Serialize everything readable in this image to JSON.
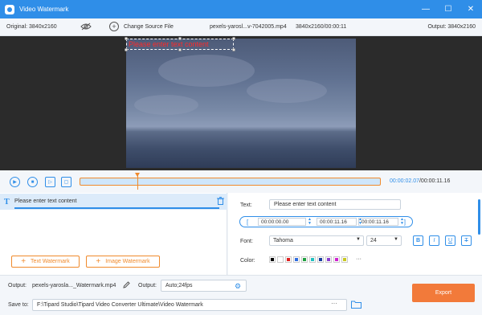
{
  "titlebar": {
    "title": "Video Watermark",
    "minimize": "—",
    "restore": "☐",
    "close": "✕"
  },
  "info": {
    "original": "Original: 3840x2160",
    "change_source": "Change Source File",
    "filename": "pexels-yarosl...v-7042005.mp4",
    "dimensions": "3840x2160/00:00:11",
    "output": "Output: 3840x2160"
  },
  "preview": {
    "watermark_text": "Please enter text content",
    "watermark_color": "#ff2a2a"
  },
  "timeline": {
    "current": "00:00:02.07",
    "total": "/00:00:11.16",
    "position": 0.19
  },
  "layers": {
    "items": [
      {
        "label": "Please enter text content"
      }
    ]
  },
  "buttons": {
    "text_watermark": "Text Watermark",
    "image_watermark": "Image Watermark",
    "plus": "+"
  },
  "properties": {
    "text_label": "Text:",
    "text_value": "Please enter text content",
    "start": "00:00:00.00",
    "duration": "00:00:11.16",
    "end": "00:00:11.16",
    "font_label": "Font:",
    "font_value": "Tahoma",
    "size_value": "24",
    "color_label": "Color:",
    "style_bold": "B",
    "style_italic": "I",
    "style_underline": "U",
    "style_strike": "T",
    "more": "···",
    "colors": [
      "#000000",
      "#ffffff",
      "#e02020",
      "#2f6de0",
      "#20a040",
      "#20c0c0",
      "#1a3fa0",
      "#8a3fd0",
      "#d020d0",
      "#c8c820"
    ]
  },
  "bottom": {
    "output_label": "Output:",
    "output_file": "pexels-yarosla..._Watermark.mp4",
    "format_label": "Output:",
    "format_value": "Auto;24fps",
    "save_label": "Save to:",
    "save_path": "F:\\Tipard Studio\\Tipard Video Converter Ultimate\\Video Watermark",
    "dots": "···",
    "export": "Export"
  },
  "colors": {
    "accent": "#2f8ee8",
    "export": "#f27a3a",
    "orange": "#f08a2c"
  }
}
